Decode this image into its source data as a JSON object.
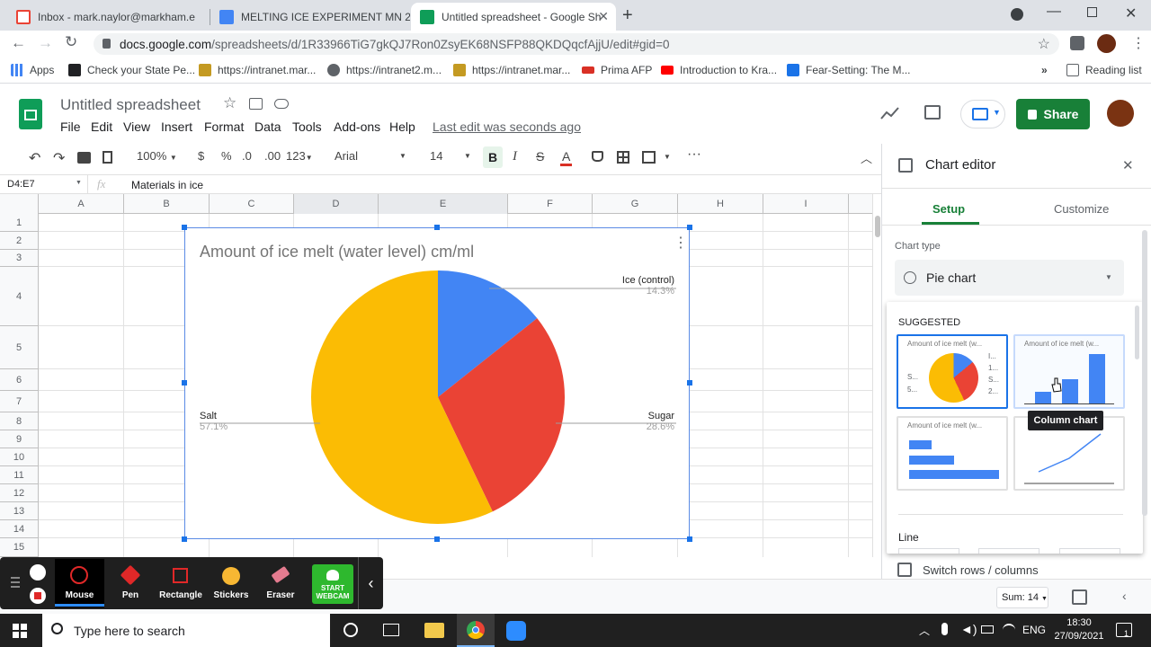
{
  "browser": {
    "tabs": [
      {
        "title": "Inbox - mark.naylor@markham.e",
        "icon": "gmail-icon"
      },
      {
        "title": "MELTING ICE EXPERIMENT MN 2",
        "icon": "docs-icon"
      },
      {
        "title": "Untitled spreadsheet - Google Sh",
        "icon": "sheets-icon",
        "active": true
      }
    ],
    "url_host": "docs.google.com",
    "url_path": "/spreadsheets/d/1R33966TiG7gkQJ7Ron0ZsyEK68NSFP88QKDQqcfAjjU/edit#gid=0",
    "bookmarks": [
      {
        "label": "Apps",
        "color": "#4285f4"
      },
      {
        "label": "Check your State Pe...",
        "color": "#202124"
      },
      {
        "label": "https://intranet.mar...",
        "color": "#c49a22"
      },
      {
        "label": "https://intranet2.m...",
        "color": "#5f6368"
      },
      {
        "label": "https://intranet.mar...",
        "color": "#c49a22"
      },
      {
        "label": "Prima AFP",
        "color": "#d93025"
      },
      {
        "label": "Introduction to Kra...",
        "color": "#ff0000"
      },
      {
        "label": "Fear-Setting: The M...",
        "color": "#1a73e8"
      }
    ],
    "reading_list": "Reading list"
  },
  "sheets": {
    "doc_title": "Untitled spreadsheet",
    "menus": [
      "File",
      "Edit",
      "View",
      "Insert",
      "Format",
      "Data",
      "Tools",
      "Add-ons",
      "Help"
    ],
    "last_edit": "Last edit was seconds ago",
    "share_label": "Share",
    "toolbar": {
      "zoom": "100%",
      "currency": "$",
      "percent": "%",
      "dec_decrease": ".0",
      "dec_increase": ".00",
      "format_more": "123",
      "font": "Arial",
      "font_size": "14",
      "bold": "B",
      "italic": "I",
      "strike": "S",
      "text_color": "A",
      "more": "···"
    },
    "name_box": "D4:E7",
    "fx": "fx",
    "formula": "Materials in ice",
    "columns": [
      "A",
      "B",
      "C",
      "D",
      "E",
      "F",
      "G",
      "H",
      "I"
    ],
    "rows": [
      "1",
      "2",
      "3",
      "4",
      "5",
      "6",
      "7",
      "8",
      "9",
      "10",
      "11",
      "12",
      "13",
      "14",
      "15"
    ],
    "sum_label": "Sum: 14"
  },
  "chart_data": {
    "type": "pie",
    "title": "Amount of ice melt (water level) cm/ml",
    "slices": [
      {
        "label": "Ice (control)",
        "percent_label": "14.3%",
        "value": 14.3,
        "color": "#4285f4"
      },
      {
        "label": "Sugar",
        "percent_label": "28.6%",
        "value": 28.6,
        "color": "#ea4335"
      },
      {
        "label": "Salt",
        "percent_label": "57.1%",
        "value": 57.1,
        "color": "#fbbc04"
      }
    ]
  },
  "editor": {
    "title": "Chart editor",
    "tab_setup": "Setup",
    "tab_customize": "Customize",
    "chart_type_label": "Chart type",
    "chart_type_value": "Pie chart",
    "suggested_label": "SUGGESTED",
    "thumb_title": "Amount of ice melt (w...",
    "thumb_pie_letters": [
      "S...",
      "5...",
      "I...",
      "1...",
      "S...",
      "2..."
    ],
    "tooltip": "Column chart",
    "line_label": "Line",
    "switch_label": "Switch rows / columns"
  },
  "zoom_toolbar": {
    "items": [
      "Mouse",
      "Pen",
      "Rectangle",
      "Stickers",
      "Eraser"
    ],
    "webcam": "START WEBCAM"
  },
  "taskbar": {
    "search_placeholder": "Type here to search",
    "lang": "ENG",
    "time": "18:30",
    "date": "27/09/2021",
    "notif_count": "1"
  }
}
